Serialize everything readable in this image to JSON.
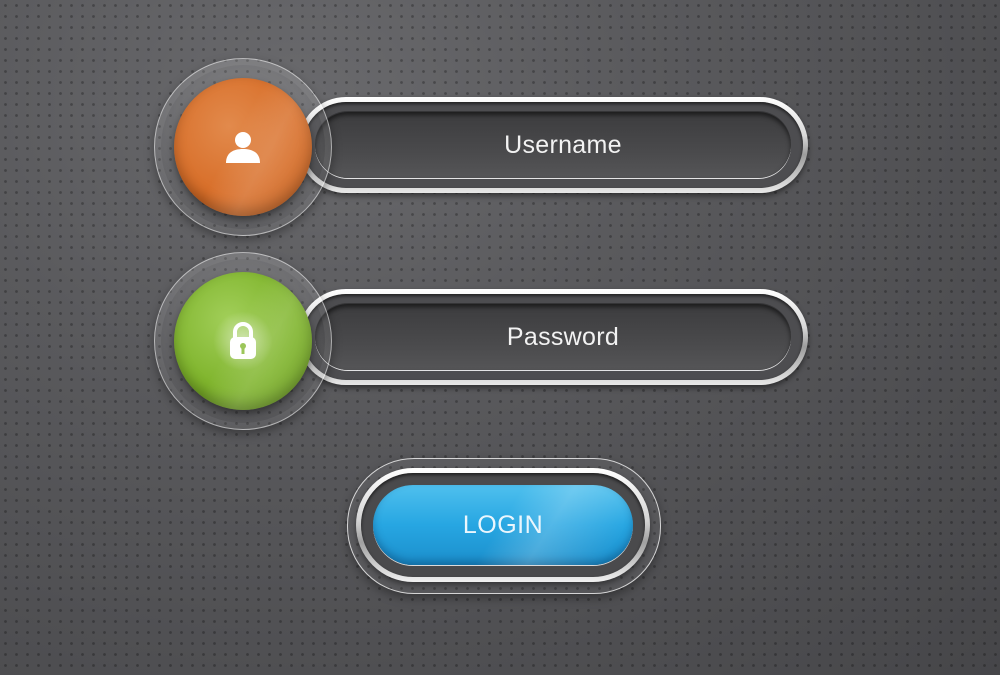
{
  "form": {
    "username": {
      "label": "Username",
      "icon": "user-icon",
      "accent": "#d86f2a"
    },
    "password": {
      "label": "Password",
      "icon": "padlock-icon",
      "accent": "#7fb42c"
    },
    "login": {
      "label": "LOGIN",
      "accent": "#27a6e2"
    }
  }
}
